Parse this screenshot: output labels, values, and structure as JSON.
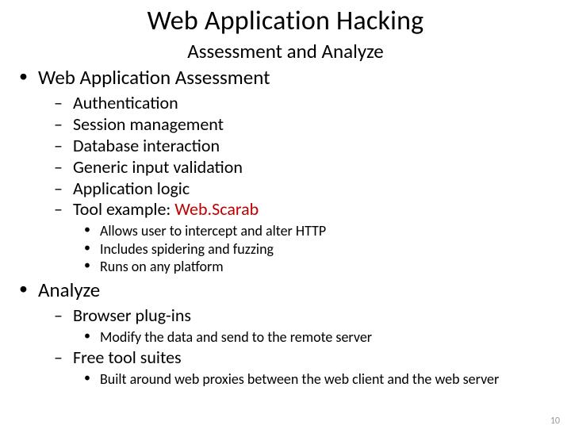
{
  "title": "Web Application Hacking",
  "subtitle": "Assessment and Analyze",
  "sections": {
    "assessment": {
      "label": "Web Application Assessment",
      "items": [
        "Authentication",
        "Session management",
        "Database interaction",
        "Generic input validation",
        "Application logic"
      ],
      "tool_prefix": "Tool example: ",
      "tool_name": "Web.Scarab",
      "tool_notes": [
        "Allows user to intercept and alter HTTP",
        "Includes spidering and fuzzing",
        "Runs on any platform"
      ]
    },
    "analyze": {
      "label": "Analyze",
      "browser_plugins": {
        "label": "Browser plug-ins",
        "notes": [
          "Modify the data and send to the remote server"
        ]
      },
      "free_tool_suites": {
        "label": "Free tool suites",
        "notes": [
          "Built around web proxies between the web client and the web server"
        ]
      }
    }
  },
  "page_number": "10"
}
